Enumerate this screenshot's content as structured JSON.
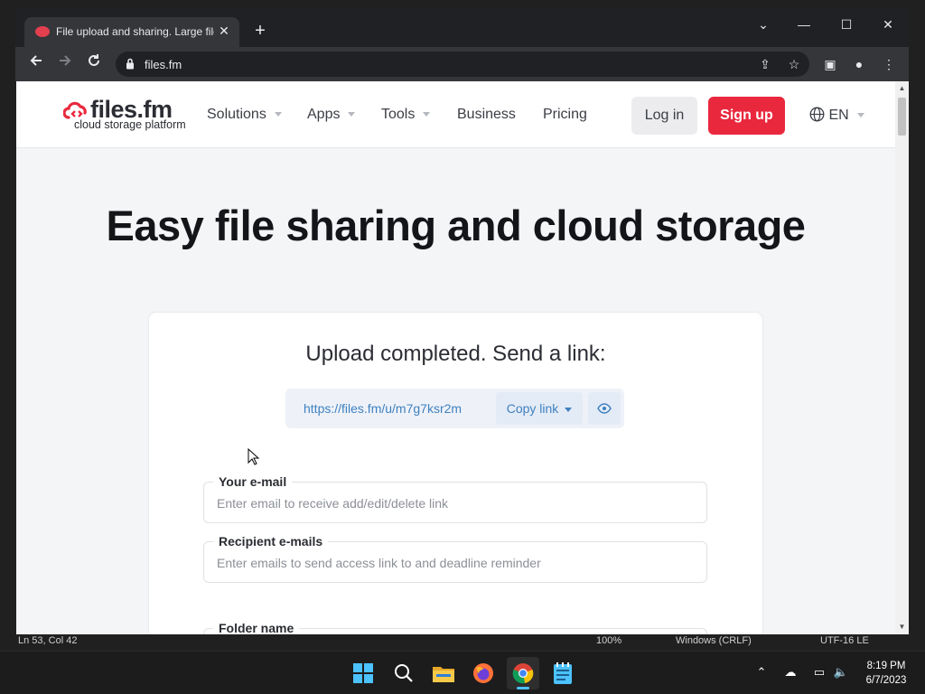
{
  "background_app": {
    "status_position": "Ln 53, Col 42",
    "zoom": "100%",
    "line_ending": "Windows (CRLF)",
    "encoding": "UTF-16 LE"
  },
  "browser": {
    "tab_title": "File upload and sharing. Large files",
    "url": "files.fm",
    "icons": {
      "back": "arrow-left-icon",
      "forward": "arrow-right-icon",
      "reload": "reload-icon",
      "lock": "lock-icon",
      "share": "share-icon",
      "bookmark": "star-icon",
      "side_panel": "side-panel-icon",
      "profile": "profile-icon",
      "menu": "kebab-menu-icon"
    }
  },
  "site": {
    "logo_text": "files.fm",
    "logo_sub": "cloud storage platform",
    "menu": [
      {
        "label": "Solutions",
        "dropdown": true
      },
      {
        "label": "Apps",
        "dropdown": true
      },
      {
        "label": "Tools",
        "dropdown": true
      },
      {
        "label": "Business",
        "dropdown": false
      },
      {
        "label": "Pricing",
        "dropdown": false
      }
    ],
    "login_label": "Log in",
    "signup_label": "Sign up",
    "language": "EN",
    "brand_color": "#e9283e"
  },
  "hero": {
    "title": "Easy file sharing and cloud storage"
  },
  "upload": {
    "title": "Upload completed. Send a link:",
    "link_url": "https://files.fm/u/m7g7ksr2m",
    "copy_label": "Copy link",
    "fields": [
      {
        "label": "Your e-mail",
        "value": "",
        "placeholder": "Enter email to receive add/edit/delete link"
      },
      {
        "label": "Recipient e-mails",
        "value": "",
        "placeholder": "Enter emails to send access link to and deadline reminder"
      },
      {
        "label": "Folder name",
        "value": "",
        "placeholder": ""
      }
    ]
  },
  "taskbar": {
    "apps": [
      "start-icon",
      "search-icon",
      "file-explorer-icon",
      "firefox-icon",
      "chrome-icon",
      "notepad-icon"
    ],
    "active_app": "chrome-icon",
    "time": "8:19 PM",
    "date": "6/7/2023"
  }
}
